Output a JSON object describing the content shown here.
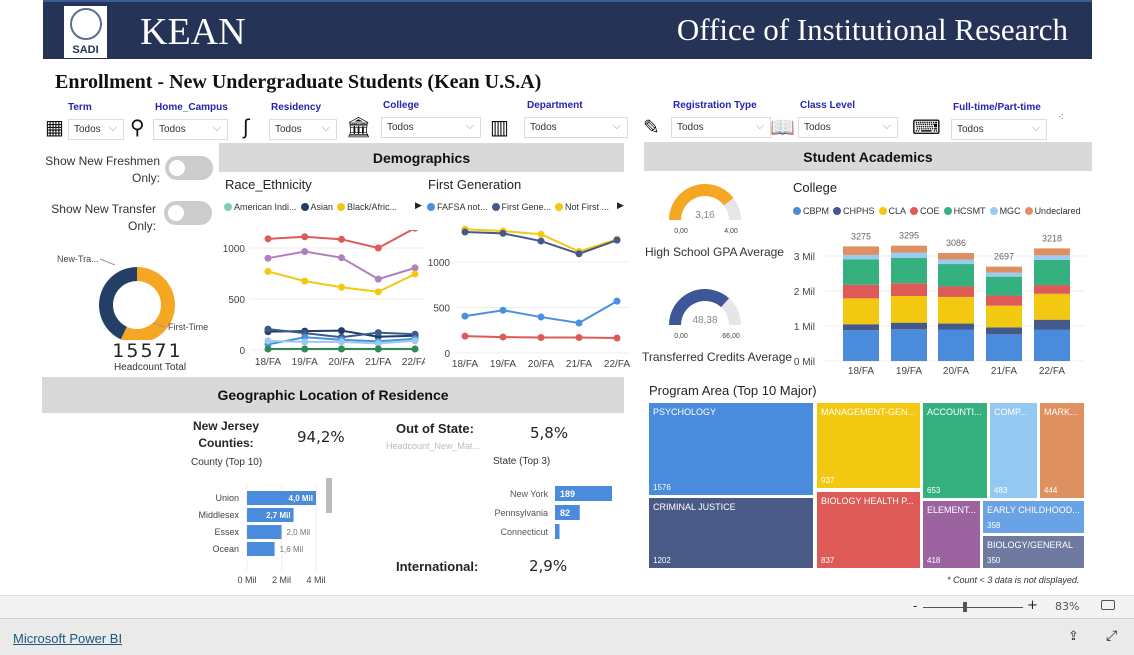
{
  "header": {
    "logo_text": "SADI",
    "brand": "KEAN",
    "office": "Office of Institutional Research"
  },
  "page_title": "Enrollment - New Undergraduate Students  (Kean U.S.A)",
  "filters": [
    {
      "label": "Term",
      "value": "Todos",
      "icon": "calendar-icon"
    },
    {
      "label": "Home_Campus",
      "value": "Todos",
      "icon": "map-pin-icon"
    },
    {
      "label": "Residency",
      "value": "Todos",
      "icon": "new-jersey-icon"
    },
    {
      "label": "College",
      "value": "Todos",
      "icon": "college-building-icon"
    },
    {
      "label": "Department",
      "value": "Todos",
      "icon": "office-building-icon"
    },
    {
      "label": "Registration Type",
      "value": "Todos",
      "icon": "form-edit-icon"
    },
    {
      "label": "Class Level",
      "value": "Todos",
      "icon": "open-book-icon"
    },
    {
      "label": "Full-time/Part-time",
      "value": "Todos",
      "icon": "student-desk-icon"
    }
  ],
  "toggles": [
    {
      "label": "Show New Freshmen Only:",
      "on": false
    },
    {
      "label": "Show New Transfer Only:",
      "on": false
    }
  ],
  "demographics": {
    "title": "Demographics"
  },
  "academics": {
    "title": "Student Academics"
  },
  "geo": {
    "title": "Geographic Location of Residence"
  },
  "donut": {
    "slices": [
      {
        "name": "First-Time",
        "share": 0.57,
        "color": "#F5A623"
      },
      {
        "name": "New-Tra...",
        "share": 0.43,
        "color": "#243F66"
      }
    ],
    "headcount": "15571",
    "headcount_label": "Headcount Total"
  },
  "chart_data": [
    {
      "type": "line",
      "title": "Race_Ethnicity",
      "categories": [
        "18/FA",
        "19/FA",
        "20/FA",
        "21/FA",
        "22/FA"
      ],
      "ylim": [
        0,
        1250
      ],
      "yticks": [
        "0",
        "500",
        "1000"
      ],
      "legend": [
        {
          "name": "American Indi...",
          "color": "#7CCFB0"
        },
        {
          "name": "Asian",
          "color": "#1F3E66"
        },
        {
          "name": "Black/Afric...",
          "color": "#F2C811"
        }
      ],
      "series": [
        {
          "color": "#DE5A57",
          "values": [
            1090,
            1110,
            1085,
            1000,
            1195
          ]
        },
        {
          "color": "#B07FC0",
          "values": [
            900,
            965,
            905,
            695,
            805
          ]
        },
        {
          "name": "Black/Afric...",
          "color": "#F2C811",
          "values": [
            770,
            675,
            615,
            570,
            745
          ]
        },
        {
          "name": "Asian",
          "color": "#1F3E66",
          "values": [
            180,
            185,
            190,
            130,
            140
          ]
        },
        {
          "color": "#3C5A8A",
          "values": [
            205,
            165,
            125,
            170,
            155
          ]
        },
        {
          "color": "#4A90E2",
          "values": [
            55,
            125,
            100,
            85,
            110
          ]
        },
        {
          "color": "#9CC8F0",
          "values": [
            90,
            80,
            80,
            65,
            90
          ]
        },
        {
          "color": "#2E8B57",
          "values": [
            10,
            10,
            10,
            10,
            10
          ]
        }
      ]
    },
    {
      "type": "line",
      "title": "First Generation",
      "categories": [
        "18/FA",
        "19/FA",
        "20/FA",
        "21/FA",
        "22/FA"
      ],
      "ylim": [
        0,
        1450
      ],
      "yticks": [
        "0",
        "500",
        "1000"
      ],
      "legend": [
        {
          "name": "FAFSA not...",
          "color": "#4A90E2"
        },
        {
          "name": "First Gene...",
          "color": "#44598A"
        },
        {
          "name": "Not First ...",
          "color": "#F2C811"
        }
      ],
      "series": [
        {
          "name": "Not First ...",
          "color": "#F2C811",
          "values": [
            1360,
            1340,
            1305,
            1115,
            1250
          ]
        },
        {
          "name": "First Gene...",
          "color": "#44598A",
          "values": [
            1330,
            1315,
            1230,
            1090,
            1240
          ]
        },
        {
          "name": "FAFSA not...",
          "color": "#4A90E2",
          "values": [
            405,
            470,
            395,
            330,
            570
          ]
        },
        {
          "color": "#DE5A57",
          "values": [
            185,
            175,
            170,
            170,
            165
          ]
        }
      ]
    },
    {
      "type": "bar",
      "stacked": true,
      "title": "College",
      "categories": [
        "18/FA",
        "19/FA",
        "20/FA",
        "21/FA",
        "22/FA"
      ],
      "yticks": [
        "0 Mil",
        "1 Mil",
        "2 Mil",
        "3 Mil"
      ],
      "totals": [
        "3275",
        "3295",
        "3086",
        "2697",
        "3218"
      ],
      "series": [
        {
          "name": "CBPM",
          "color": "#4A8BDB",
          "values": [
            880,
            905,
            900,
            760,
            900
          ]
        },
        {
          "name": "CHPHS",
          "color": "#44598A",
          "values": [
            170,
            190,
            170,
            200,
            280
          ]
        },
        {
          "name": "CLA",
          "color": "#F2C811",
          "values": [
            740,
            762,
            760,
            620,
            740
          ]
        },
        {
          "name": "COE",
          "color": "#DE5A57",
          "values": [
            390,
            363,
            300,
            290,
            250
          ]
        },
        {
          "name": "HCSMT",
          "color": "#35B07F",
          "values": [
            720,
            730,
            640,
            540,
            720
          ]
        },
        {
          "name": "MGC",
          "color": "#9ACBF0",
          "values": [
            130,
            150,
            130,
            120,
            130
          ]
        },
        {
          "name": "Undeclared",
          "color": "#E09060",
          "values": [
            245,
            195,
            186,
            167,
            198
          ]
        }
      ]
    },
    {
      "type": "bar",
      "orientation": "horizontal",
      "title": "County (Top 10)",
      "categories": [
        "Union",
        "Middlesex",
        "Essex",
        "Ocean"
      ],
      "values": [
        4.0,
        2.7,
        2.0,
        1.6
      ],
      "labels": [
        "4,0 Mil",
        "2,7 Mil",
        "2,0 Mil",
        "1,6 Mil"
      ],
      "xticks": [
        "0 Mil",
        "2 Mil",
        "4 Mil"
      ],
      "xlim": [
        0,
        4
      ]
    },
    {
      "type": "bar",
      "orientation": "horizontal",
      "title": "State (Top 3)",
      "categories": [
        "New York",
        "Pennsylvania",
        "Connecticut"
      ],
      "values": [
        189,
        82,
        15
      ],
      "labels": [
        "189",
        "82",
        ""
      ]
    },
    {
      "type": "treemap",
      "title": "Program Area (Top 10 Major)",
      "items": [
        {
          "name": "PSYCHOLOGY",
          "value": "1576",
          "color": "#4A8BDB"
        },
        {
          "name": "CRIMINAL JUSTICE",
          "value": "1202",
          "color": "#4A5A86"
        },
        {
          "name": "MANAGEMENT-GEN...",
          "value": "937",
          "color": "#F2C811"
        },
        {
          "name": "BIOLOGY HEALTH P...",
          "value": "837",
          "color": "#DE5A57"
        },
        {
          "name": "ACCOUNTI...",
          "value": "653",
          "color": "#35B07F"
        },
        {
          "name": "COMP...",
          "value": "483",
          "color": "#95C8F0"
        },
        {
          "name": "MARK...",
          "value": "444",
          "color": "#DE9060"
        },
        {
          "name": "ELEMENT...",
          "value": "418",
          "color": "#9B63A0"
        },
        {
          "name": "EARLY CHILDHOOD...",
          "value": "358",
          "color": "#6AA2E6"
        },
        {
          "name": "BIOLOGY/GENERAL",
          "value": "350",
          "color": "#6E7AA0"
        }
      ]
    }
  ],
  "gauges": [
    {
      "value": 3.16,
      "value_text": "3,16",
      "min": "0,00",
      "max": "4,00",
      "max_num": 4,
      "label": "High School GPA Average",
      "color": "#F5A623"
    },
    {
      "value": 48.38,
      "value_text": "48,38",
      "min": "0,00",
      "max": "66,00",
      "max_num": 66,
      "label": "Transferred Credits Average",
      "color": "#3D5898"
    }
  ],
  "kpis": {
    "nj_label": "New Jersey Counties:",
    "nj_value": "94,2%",
    "oos_label": "Out of State:",
    "oos_value": "5,8%",
    "oos_sub": "Headcount_New_Mat...",
    "intl_label": "International:",
    "intl_value": "2,9%"
  },
  "footnote": "* Count < 3 data is not displayed.",
  "zoom": {
    "minus": "-",
    "plus": "+",
    "level": "83%",
    "slider_fraction": 0.42
  },
  "footer": {
    "link": "Microsoft Power BI"
  }
}
